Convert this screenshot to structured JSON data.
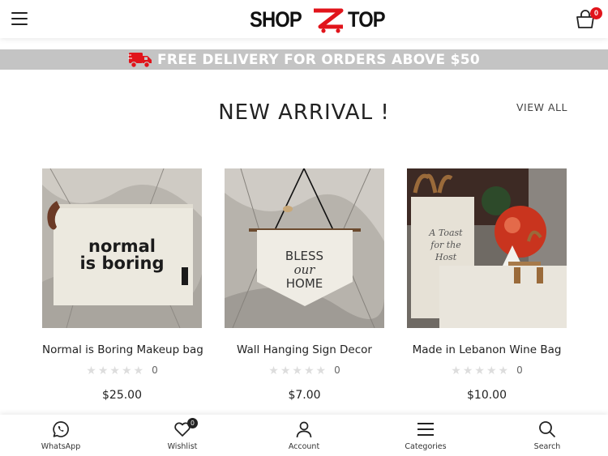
{
  "header": {
    "logo_left": "SHOP",
    "logo_right": "TOP",
    "cart_count": "0",
    "brand_color": "#e1141b"
  },
  "banner": {
    "text": "FREE DELIVERY FOR ORDERS ABOVE $50",
    "background": "#c4c4c4"
  },
  "section": {
    "title": "NEW ARRIVAL !",
    "view_all": "VIEW ALL"
  },
  "products": [
    {
      "name": "Normal is Boring Makeup bag",
      "rating_count": "0",
      "price": "$25.00",
      "image_text_1": "normal",
      "image_text_2": "is boring"
    },
    {
      "name": "Wall Hanging Sign Decor",
      "rating_count": "0",
      "price": "$7.00",
      "image_text_1": "BLESS",
      "image_text_2": "our",
      "image_text_3": "HOME"
    },
    {
      "name": "Made in Lebanon Wine Bag",
      "rating_count": "0",
      "price": "$10.00",
      "image_text_1": "A Toast",
      "image_text_2": "for the",
      "image_text_3": "Host"
    }
  ],
  "bottom_nav": {
    "whatsapp": "WhatsApp",
    "wishlist": "Wishlist",
    "wishlist_count": "0",
    "account": "Account",
    "categories": "Categories",
    "search": "Search"
  },
  "icons": [
    "menu-icon",
    "cart-icon",
    "truck-icon",
    "whatsapp-icon",
    "heart-icon",
    "user-icon",
    "categories-icon",
    "search-icon",
    "star-icon"
  ]
}
